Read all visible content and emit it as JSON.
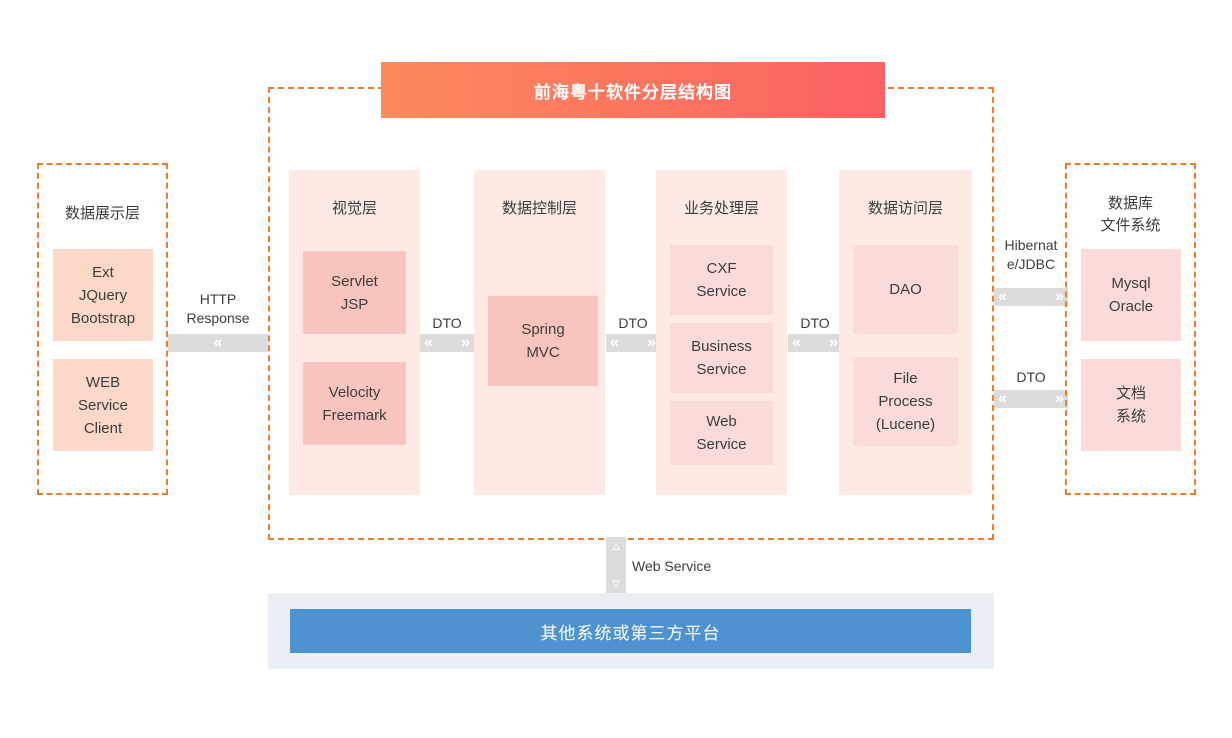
{
  "diagram": {
    "title": "前海粤十软件分层结构图",
    "presentation_group": {
      "label": "数据展示层",
      "boxes": [
        {
          "text": "Ext\nJQuery\nBootstrap"
        },
        {
          "text": "WEB\nService\nClient"
        }
      ]
    },
    "layers": [
      {
        "title": "视觉层",
        "boxes": [
          {
            "text": "Servlet\nJSP"
          },
          {
            "text": "Velocity\nFreemark"
          }
        ]
      },
      {
        "title": "数据控制层",
        "boxes": [
          {
            "text": "Spring\nMVC"
          }
        ]
      },
      {
        "title": "业务处理层",
        "boxes": [
          {
            "text": "CXF\nService"
          },
          {
            "text": "Business\nService"
          },
          {
            "text": "Web\nService"
          }
        ]
      },
      {
        "title": "数据访问层",
        "boxes": [
          {
            "text": "DAO"
          },
          {
            "text": "File\nProcess\n(Lucene)"
          }
        ]
      }
    ],
    "storage_group": {
      "label": "数据库\n文件系统",
      "boxes": [
        {
          "text": "Mysql\nOracle"
        },
        {
          "text": "文档\n系统"
        }
      ]
    },
    "connectors": [
      {
        "name": "http-response",
        "label": "HTTP\nResponse",
        "direction": "left"
      },
      {
        "name": "dto-visual-control",
        "label": "DTO",
        "direction": "both"
      },
      {
        "name": "dto-control-business",
        "label": "DTO",
        "direction": "both"
      },
      {
        "name": "dto-business-dao",
        "label": "DTO",
        "direction": "both"
      },
      {
        "name": "hibernate-jdbc",
        "label": "Hibernat\ne/JDBC",
        "direction": "both"
      },
      {
        "name": "dto-dao-filesystem",
        "label": "DTO",
        "direction": "both"
      },
      {
        "name": "web-service-vertical",
        "label": "Web Service",
        "direction": "vertical-both"
      }
    ],
    "bottom": {
      "bar_label": "其他系统或第三方平台"
    },
    "colors": {
      "title_gradient_start": "#fb8a5c",
      "title_gradient_end": "#fb6263",
      "dashed_border": "#ef7c2b",
      "layer_container": "#fdeae5",
      "inner_box_peach": "#fcd8c8",
      "inner_box_pink": "#fbdada",
      "connector_gray": "#dcdcdc",
      "bottom_bar_blue": "#4e92cf",
      "bottom_band": "#eaeff6"
    },
    "chevrons": {
      "left": "«",
      "right": "»",
      "up": "˄",
      "down": "˅"
    }
  }
}
